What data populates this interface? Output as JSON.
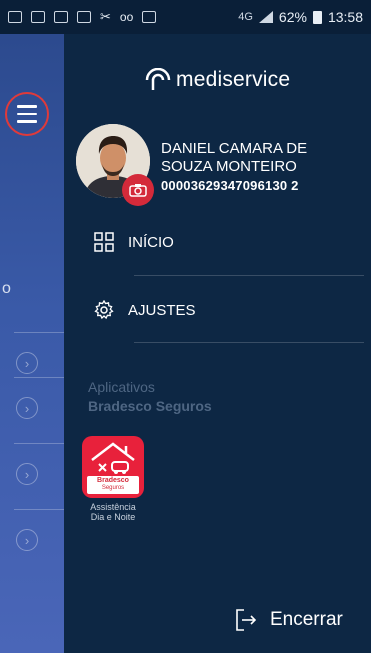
{
  "status_bar": {
    "network": "4G",
    "battery": "62%",
    "time": "13:58"
  },
  "background_app": {
    "partial_letter": "o"
  },
  "drawer": {
    "brand": "mediservice",
    "user": {
      "name": "DANIEL CAMARA DE SOUZA MONTEIRO",
      "id": "00003629347096130 2"
    },
    "nav": [
      {
        "label": "INÍCIO",
        "icon": "grid-icon"
      },
      {
        "label": "AJUSTES",
        "icon": "gear-icon"
      }
    ],
    "apps_section": {
      "title": "Aplicativos",
      "subtitle": "Bradesco Seguros",
      "apps": [
        {
          "brand_line1": "Bradesco",
          "brand_line2": "Seguros",
          "label_line1": "Assistência",
          "label_line2": "Dia e Noite"
        }
      ]
    },
    "logout_label": "Encerrar"
  },
  "colors": {
    "drawer_bg": "#0d2744",
    "accent_red": "#d42a3a",
    "muted_text": "#4e6683"
  }
}
